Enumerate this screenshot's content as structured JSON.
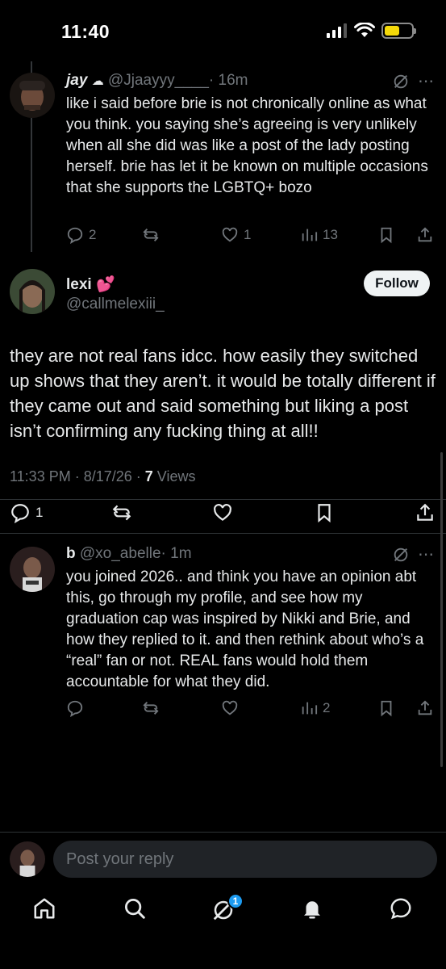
{
  "status_bar": {
    "time": "11:40",
    "battery_level": 0.55,
    "battery_color": "#f5d90a"
  },
  "reply_1": {
    "name": "jay",
    "handle": "@Jjaayyy____",
    "age": "· 16m",
    "text": "like i said before brie is not chronically online as what you think. you saying she’s agreeing is very unlikely when all she did was like a post of the lady posting herself. brie has let it be known on multiple occasions that she supports the LGBTQ+ bozo",
    "replies": "2",
    "likes": "1",
    "views": "13"
  },
  "main_post": {
    "name": "lexi",
    "emoji": "💕",
    "handle": "@callmelexiii_",
    "follow_label": "Follow",
    "text": "they are not real fans idcc. how easily they switched up shows that they aren’t. it would be totally different if they came out and said something but liking a post isn’t confirming any fucking thing at all!!",
    "timestamp": "11:33 PM · 8/17/26 · ",
    "views_count": "7",
    "views_label": " Views",
    "replies": "1"
  },
  "reply_2": {
    "name": "b",
    "handle": "@xo_abelle",
    "age": "· 1m",
    "text": "you joined 2026.. and think you have an opinion abt this, go through my profile, and see how my graduation cap was inspired by Nikki and Brie, and how they replied to it. and then rethink about who’s a “real” fan or not. REAL fans would hold them accountable for what they did.",
    "views": "2"
  },
  "composer": {
    "placeholder": "Post your reply"
  },
  "bottom_nav": {
    "notification_badge": "1"
  },
  "colors": {
    "accent": "#1d9bf0",
    "muted": "#71767b",
    "text": "#e7e9ea",
    "background": "#000000"
  }
}
